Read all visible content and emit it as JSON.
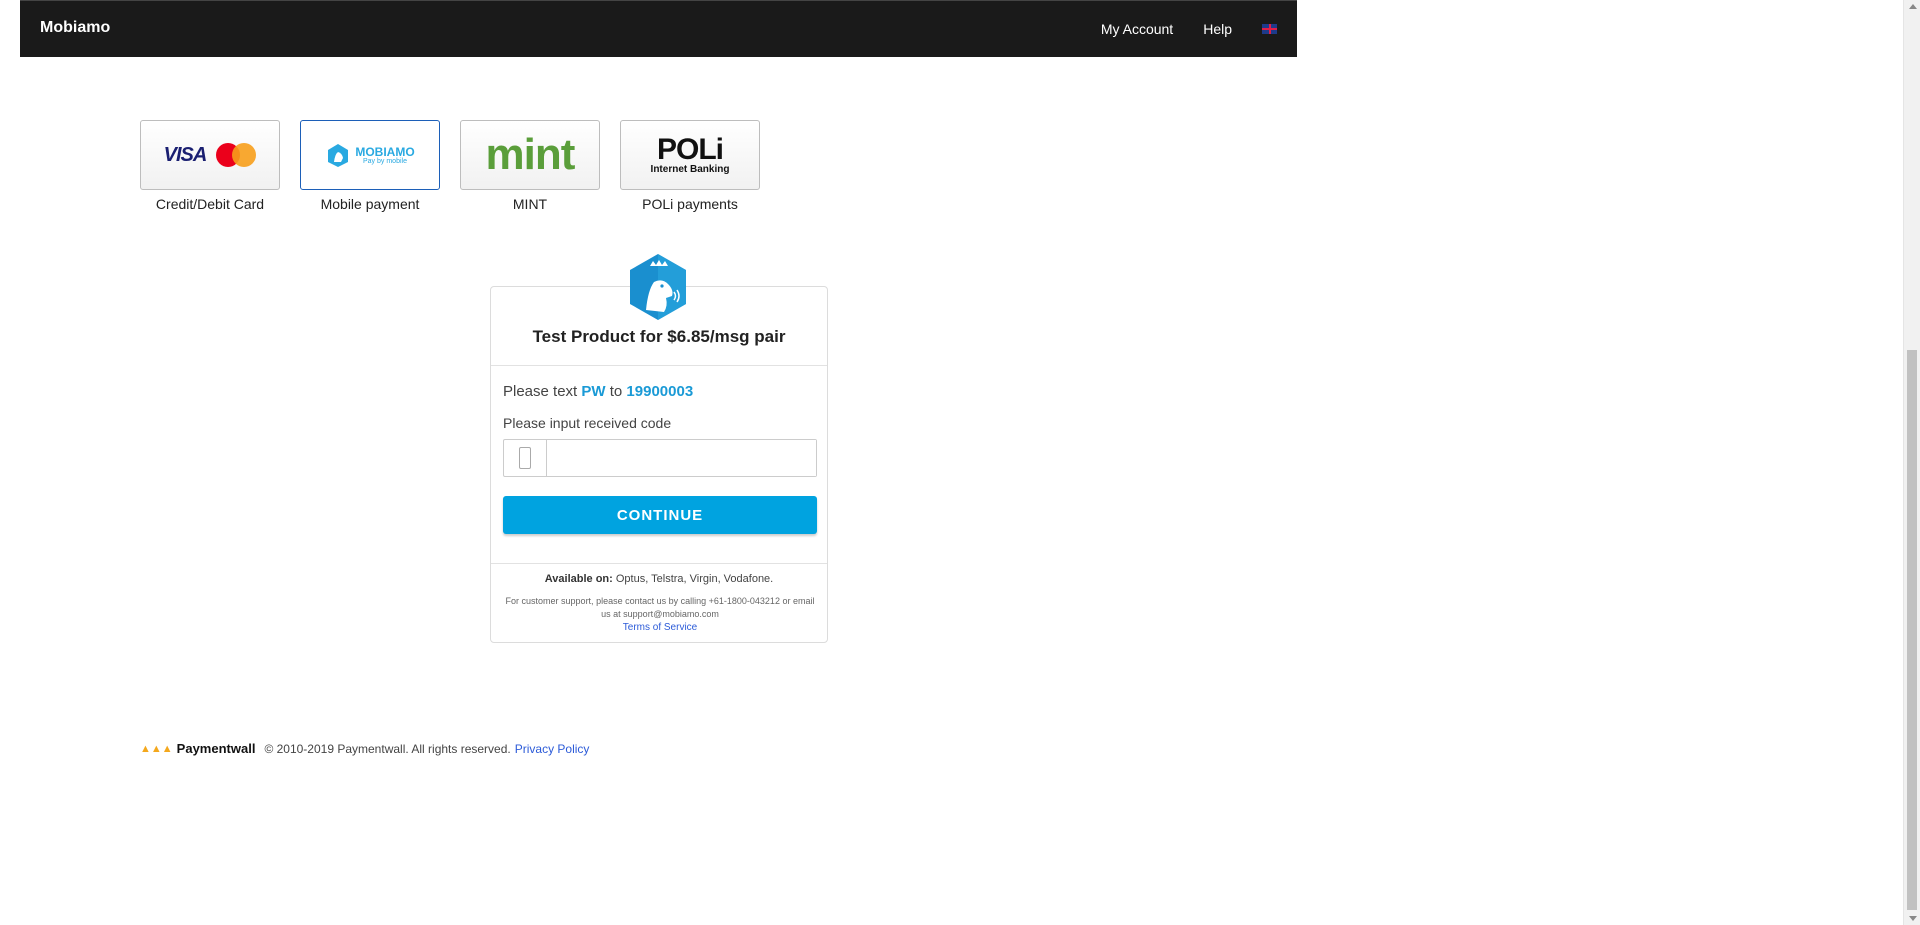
{
  "header": {
    "brand": "Mobiamo",
    "nav": {
      "account": "My Account",
      "help": "Help",
      "language_icon": "uk-flag-icon"
    }
  },
  "payment_methods": [
    {
      "label": "Credit/Debit Card",
      "logo": "visa-mastercard-logo",
      "selected": false
    },
    {
      "label": "Mobile payment",
      "logo": "mobiamo-logo",
      "logo_text": "MOBIAMO",
      "logo_sub": "Pay by mobile",
      "selected": true
    },
    {
      "label": "MINT",
      "logo": "mint-logo",
      "logo_text": "mint",
      "selected": false
    },
    {
      "label": "POLi payments",
      "logo": "poli-logo",
      "logo_text": "POLi",
      "logo_sub": "Internet Banking",
      "selected": false
    }
  ],
  "logos": {
    "visa_text": "VISA",
    "mastercard_text": "MasterCard"
  },
  "card": {
    "product_title": "Test Product for $6.85/msg pair",
    "instruction": {
      "prefix": "Please text",
      "keyword": "PW",
      "middle": "to",
      "number": "19900003"
    },
    "input_label": "Please input received code",
    "input_value": "",
    "input_placeholder": "",
    "button_label": "CONTINUE",
    "available_label": "Available on:",
    "available_carriers": "Optus, Telstra, Virgin, Vodafone.",
    "support_text": "For customer support, please contact us by calling +61-1800-043212 or email us at support@mobiamo.com",
    "terms_link": "Terms of Service"
  },
  "footer": {
    "brand": "Paymentwall",
    "copyright": "© 2010-2019 Paymentwall. All rights reserved.",
    "privacy": "Privacy Policy"
  },
  "colors": {
    "accent": "#00a3e0",
    "link": "#2c5bd8",
    "topbar": "#1a1a1a",
    "mint": "#5a9e3a"
  }
}
